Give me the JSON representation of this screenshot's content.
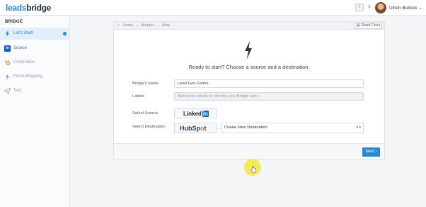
{
  "app": {
    "logo_part1": "leads",
    "logo_part2": "bridge",
    "help_glyph": "i",
    "user_name": "Ulrich Bullock",
    "user_menu_glyph": "⌄",
    "close_glyph": "✕"
  },
  "sidebar": {
    "title": "BRIDGE",
    "items": [
      {
        "label": "Let's Start!",
        "icon": "bolt-icon",
        "state": "active"
      },
      {
        "label": "Source",
        "icon": "linkedin-icon",
        "state": "done"
      },
      {
        "label": "Destination",
        "icon": "hubspot-icon",
        "state": "pending"
      },
      {
        "label": "Fields Mapping",
        "icon": "bolt-icon",
        "state": "pending"
      },
      {
        "label": "Test",
        "icon": "paper-plane-icon",
        "state": "pending"
      }
    ],
    "li_glyph": "in"
  },
  "breadcrumb": {
    "home": "Home",
    "sep": "›",
    "bridges": "Bridges",
    "current": "New"
  },
  "read_docs": "Read Docs",
  "heading": "Ready to start? Choose a source and a destination.",
  "form": {
    "name_label": "Bridge's name",
    "name_value": "Lead Gen Forms",
    "labels_label": "Labels",
    "labels_placeholder": "Add some labels to identify your Bridge later",
    "source_label": "Select Source",
    "source_logo_text": "Linked",
    "source_logo_in": "in",
    "destination_label": "Select Destination",
    "destination_logo_a": "HubSp",
    "destination_logo_b": "o",
    "destination_logo_c": "t",
    "separator": "-",
    "destination_select_value": "Create New Destination",
    "select_caret": "▾ ▾"
  },
  "next_label": "Next ›",
  "colors": {
    "accent": "#2a87d0",
    "linkedin": "#0a66c2",
    "hubspot_orange": "#f57722",
    "cursor_halo": "#f4e84a"
  }
}
